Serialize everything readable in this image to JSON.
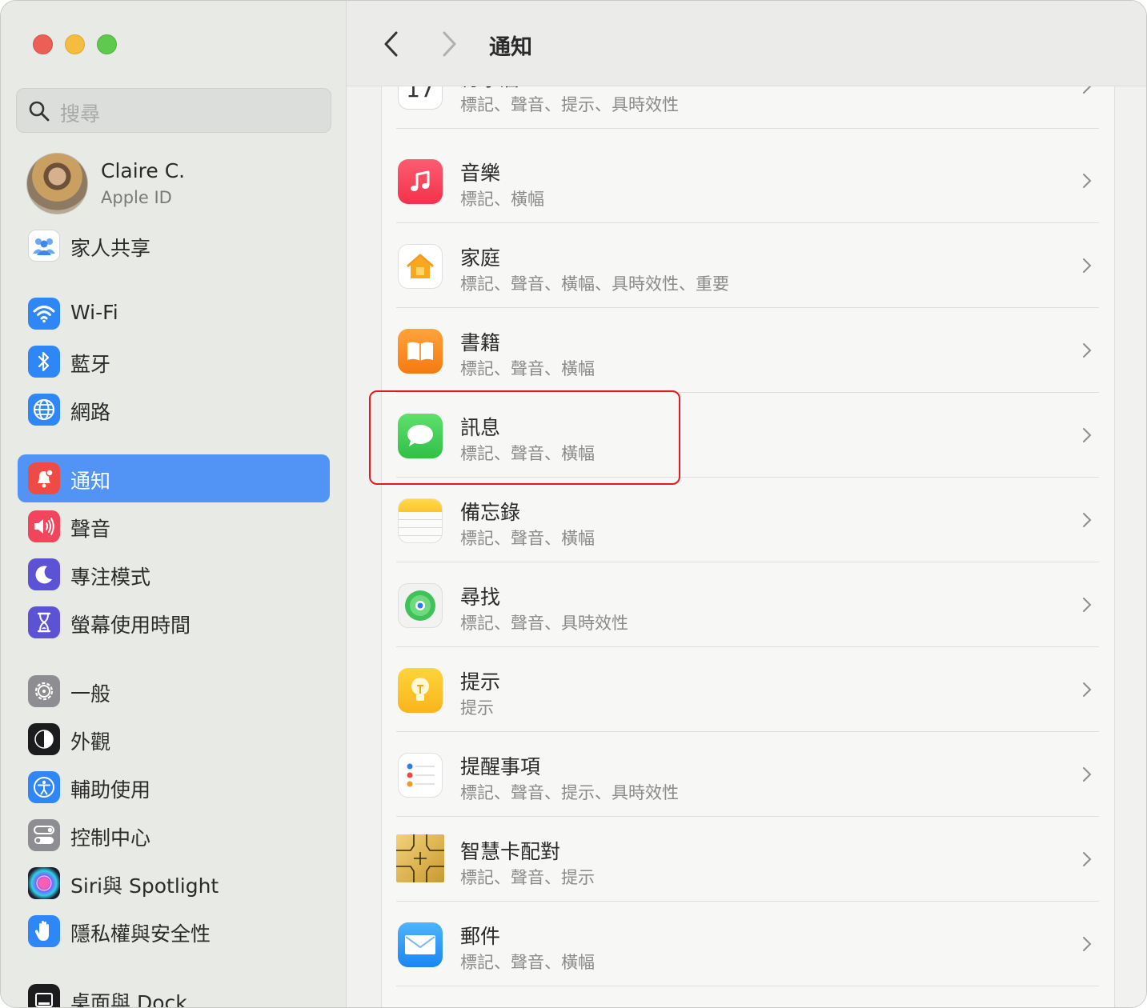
{
  "window": {
    "title": "通知"
  },
  "sidebar": {
    "search_placeholder": "搜尋",
    "account": {
      "name": "Claire C.",
      "subtitle": "Apple ID"
    },
    "items": [
      {
        "label": "家人共享",
        "icon": "family-icon",
        "color": "#ffffff"
      },
      {
        "label": "Wi-Fi",
        "icon": "wifi-icon",
        "color": "#2f86f6"
      },
      {
        "label": "藍牙",
        "icon": "bluetooth-icon",
        "color": "#2f86f6"
      },
      {
        "label": "網路",
        "icon": "globe-icon",
        "color": "#2f86f6"
      },
      {
        "label": "通知",
        "icon": "bell-icon",
        "color": "#f04a45",
        "selected": true
      },
      {
        "label": "聲音",
        "icon": "speaker-icon",
        "color": "#f0455c"
      },
      {
        "label": "專注模式",
        "icon": "moon-icon",
        "color": "#5b52d6"
      },
      {
        "label": "螢幕使用時間",
        "icon": "hourglass-icon",
        "color": "#5b52d6"
      },
      {
        "label": "一般",
        "icon": "gear-icon",
        "color": "#8e8e92"
      },
      {
        "label": "外觀",
        "icon": "appearance-icon",
        "color": "#1c1c1e"
      },
      {
        "label": "輔助使用",
        "icon": "accessibility-icon",
        "color": "#2f86f6"
      },
      {
        "label": "控制中心",
        "icon": "toggles-icon",
        "color": "#8e8e92"
      },
      {
        "label": "Siri與 Spotlight",
        "icon": "siri-icon",
        "color": "#2b2b40"
      },
      {
        "label": "隱私權與安全性",
        "icon": "hand-icon",
        "color": "#2f86f6"
      },
      {
        "label": "桌面與 Dock",
        "icon": "dock-icon",
        "color": "#1c1c1e"
      }
    ]
  },
  "main": {
    "apps": [
      {
        "title": "行事曆",
        "desc": "標記、聲音、提示、具時效性",
        "icon": "calendar-icon",
        "day": "17"
      },
      {
        "title": "音樂",
        "desc": "標記、橫幅",
        "icon": "music-icon"
      },
      {
        "title": "家庭",
        "desc": "標記、聲音、橫幅、具時效性、重要",
        "icon": "home-icon"
      },
      {
        "title": "書籍",
        "desc": "標記、聲音、橫幅",
        "icon": "books-icon"
      },
      {
        "title": "訊息",
        "desc": "標記、聲音、橫幅",
        "icon": "messages-icon"
      },
      {
        "title": "備忘錄",
        "desc": "標記、聲音、橫幅",
        "icon": "notes-icon"
      },
      {
        "title": "尋找",
        "desc": "標記、聲音、具時效性",
        "icon": "findmy-icon"
      },
      {
        "title": "提示",
        "desc": "提示",
        "icon": "tips-icon"
      },
      {
        "title": "提醒事項",
        "desc": "標記、聲音、提示、具時效性",
        "icon": "reminders-icon"
      },
      {
        "title": "智慧卡配對",
        "desc": "標記、聲音、提示",
        "icon": "smartcard-icon"
      },
      {
        "title": "郵件",
        "desc": "標記、聲音、橫幅",
        "icon": "mail-icon"
      }
    ]
  },
  "accent_color": "#5294f6",
  "highlight_color": "#e21a24"
}
